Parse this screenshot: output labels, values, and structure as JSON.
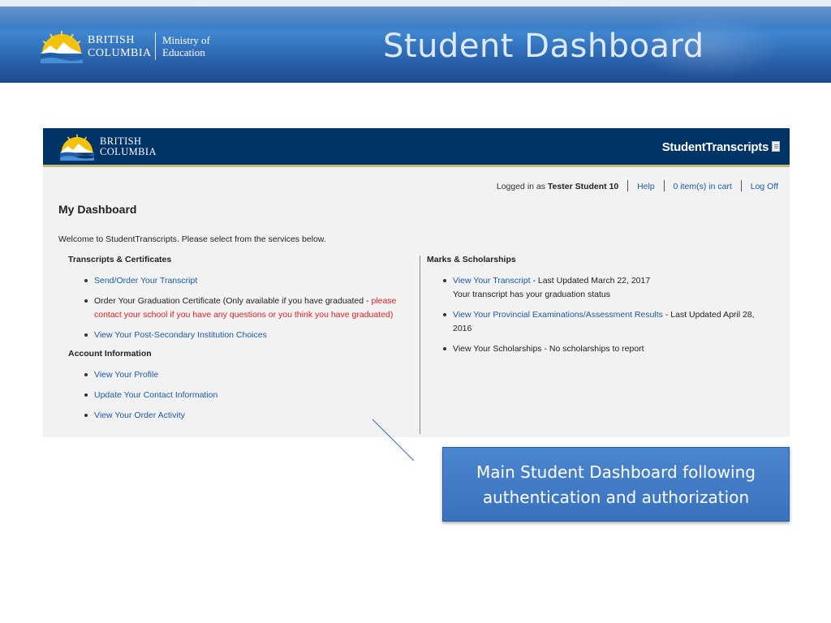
{
  "slide": {
    "title": "Student Dashboard",
    "logo": {
      "line1": "BRITISH",
      "line2": "COLUMBIA",
      "ministry_line1": "Ministry of",
      "ministry_line2": "Education"
    }
  },
  "app": {
    "logo": {
      "line1": "BRITISH",
      "line2": "COLUMBIA"
    },
    "brand": "StudentTranscripts",
    "userbar": {
      "logged_in_prefix": "Logged in as",
      "user_name": "Tester Student 10",
      "help": "Help",
      "cart": "0 item(s) in cart",
      "logoff": "Log Off"
    },
    "dashboard_title": "My Dashboard",
    "welcome": "Welcome to StudentTranscripts. Please select from the services below.",
    "left": {
      "transcripts_heading": "Transcripts & Certificates",
      "send_order": "Send/Order Your Transcript",
      "grad_cert_text": "Order Your Graduation Certificate (Only available if you have graduated - ",
      "grad_cert_warning_1": "please",
      "grad_cert_warning_2": "contact your school if you have any questions or you think you have graduated)",
      "post_secondary": "View Your Post-Secondary Institution Choices",
      "account_heading": "Account Information",
      "profile": "View Your Profile",
      "contact": "Update Your Contact Information",
      "orders": "View Your Order Activity"
    },
    "right": {
      "heading": "Marks & Scholarships",
      "transcript_link": "View Your Transcript",
      "transcript_updated": " - Last Updated March 22, 2017",
      "transcript_note": "Your transcript has your graduation status",
      "exams_link": "View Your Provincial Examinations/Assessment Results",
      "exams_updated_1": " - Last Updated April 28,",
      "exams_updated_2": "2016",
      "scholarships": "View Your Scholarships - No scholarships to report"
    }
  },
  "callout": {
    "line1": "Main Student Dashboard following",
    "line2": "authentication and authorization"
  }
}
